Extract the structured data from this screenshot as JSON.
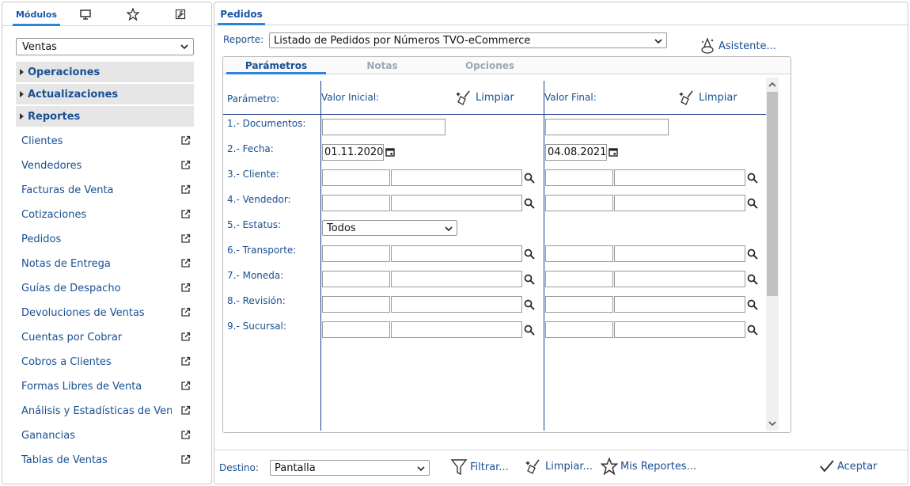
{
  "left": {
    "tabs": [
      {
        "label": "Módulos",
        "icon": null
      },
      {
        "label": "",
        "icon": "monitor-icon"
      },
      {
        "label": "",
        "icon": "star-icon"
      },
      {
        "label": "",
        "icon": "wrench-icon"
      }
    ],
    "module_select": "Ventas",
    "sections": [
      "Operaciones",
      "Actualizaciones",
      "Reportes"
    ],
    "items": [
      "Clientes",
      "Vendedores",
      "Facturas de Venta",
      "Cotizaciones",
      "Pedidos",
      "Notas de Entrega",
      "Guías de Despacho",
      "Devoluciones de Ventas",
      "Cuentas por Cobrar",
      "Cobros a Clientes",
      "Formas Libres de Venta",
      "Análisis y Estadísticas de Ven",
      "Ganancias",
      "Tablas de Ventas"
    ]
  },
  "right": {
    "tab": "Pedidos",
    "report_label": "Reporte:",
    "report_value": "Listado de Pedidos por Números TVO-eCommerce",
    "assistant_label": "Asistente...",
    "inner_tabs": [
      "Parámetros",
      "Notas",
      "Opciones"
    ],
    "columns": {
      "param": "Parámetro:",
      "initial": "Valor Inicial:",
      "final": "Valor Final:",
      "clear": "Limpiar"
    },
    "params": [
      "1.- Documentos:",
      "2.- Fecha:",
      "3.- Cliente:",
      "4.- Vendedor:",
      "5.- Estatus:",
      "6.- Transporte:",
      "7.- Moneda:",
      "8.- Revisión:",
      "9.- Sucursal:"
    ],
    "fecha_inicial": "01.11.2020",
    "fecha_final": "04.08.2021",
    "estatus_value": "Todos"
  },
  "bottom": {
    "destino_label": "Destino:",
    "destino_value": "Pantalla",
    "filtrar": "Filtrar...",
    "limpiar": "Limpiar...",
    "mis_reportes": "Mis Reportes...",
    "aceptar": "Aceptar"
  },
  "colors": {
    "accent": "#2e84d6",
    "link": "#1a4f92",
    "section_bg": "#e6e6e6",
    "grid_line": "#1e3f8a"
  }
}
